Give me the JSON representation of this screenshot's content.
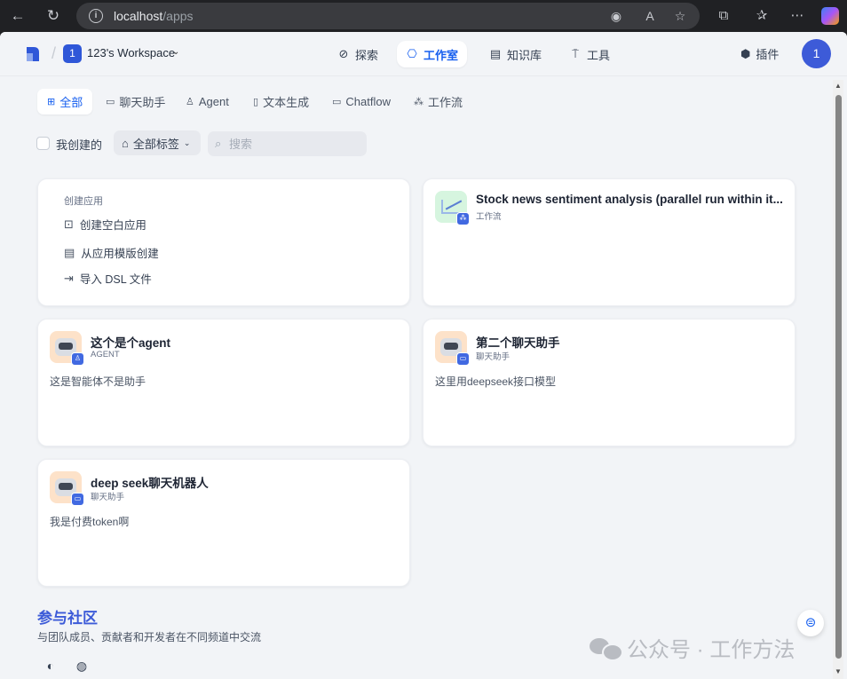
{
  "browser": {
    "url_host": "localhost",
    "url_path": "/apps"
  },
  "header": {
    "workspace_badge": "1",
    "workspace_name": "123's Workspace",
    "nav": [
      {
        "label": "探索"
      },
      {
        "label": "工作室"
      },
      {
        "label": "知识库"
      },
      {
        "label": "工具"
      }
    ],
    "plugin_label": "插件",
    "avatar_initial": "1"
  },
  "categories": [
    "全部",
    "聊天助手",
    "Agent",
    "文本生成",
    "Chatflow",
    "工作流"
  ],
  "filters": {
    "mine_label": "我创建的",
    "tags_label": "全部标签",
    "search_placeholder": "搜索"
  },
  "create_card": {
    "title": "创建应用",
    "items": [
      "创建空白应用",
      "从应用模版创建",
      "导入 DSL 文件"
    ]
  },
  "apps": [
    {
      "name": "Stock news sentiment analysis (parallel run within it...",
      "type": "工作流",
      "desc": ""
    },
    {
      "name": "这个是个agent",
      "type": "AGENT",
      "desc": "这是智能体不是助手"
    },
    {
      "name": "第二个聊天助手",
      "type": "聊天助手",
      "desc": "这里用deepseek接口模型"
    },
    {
      "name": "deep seek聊天机器人",
      "type": "聊天助手",
      "desc": "我是付费token啊"
    }
  ],
  "community": {
    "title": "参与社区",
    "subtitle": "与团队成员、贡献者和开发者在不同频道中交流"
  },
  "watermark": "公众号 · 工作方法",
  "colors": {
    "accent": "#155eef",
    "brand": "#3d5bd8",
    "background": "#f2f4f7"
  }
}
